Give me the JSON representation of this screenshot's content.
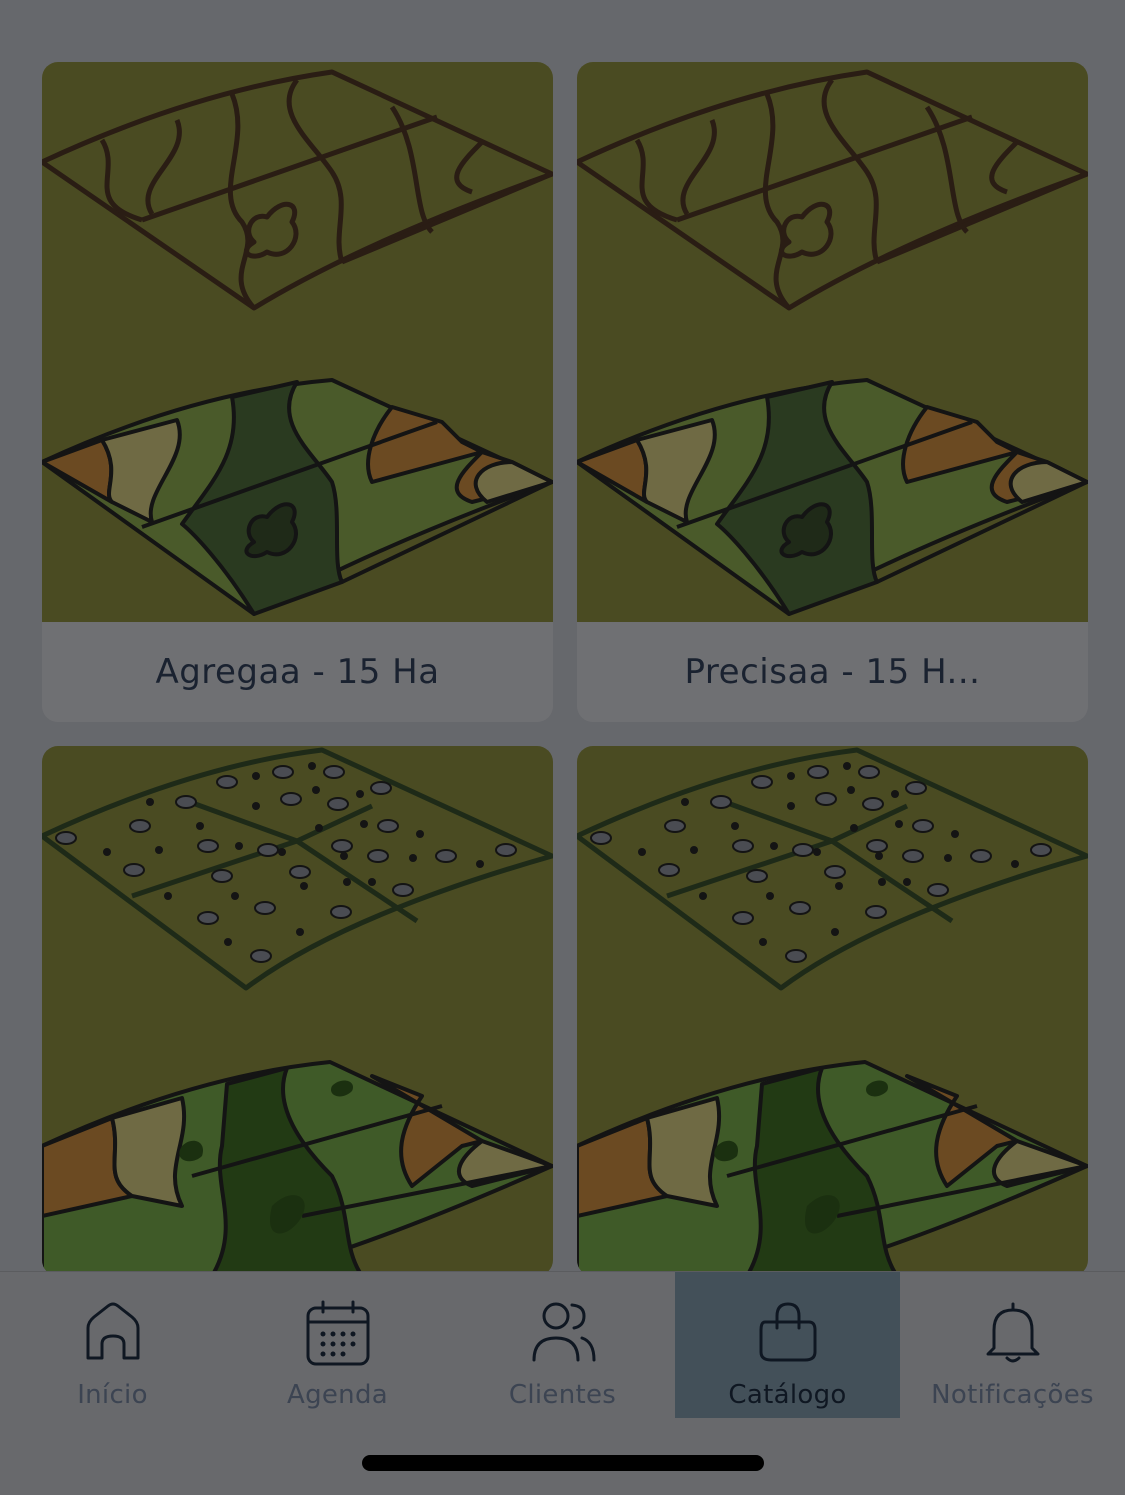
{
  "catalog": {
    "products": [
      {
        "name": "Agregaa - 15 Ha",
        "illustration": "zone-map-illustration"
      },
      {
        "name": "Precisaa - 15 H...",
        "illustration": "zone-map-illustration"
      },
      {
        "name": "",
        "illustration": "sampling-grid-illustration"
      },
      {
        "name": "",
        "illustration": "sampling-grid-illustration"
      }
    ]
  },
  "tabbar": {
    "items": [
      {
        "label": "Início",
        "icon": "home-icon",
        "active": false
      },
      {
        "label": "Agenda",
        "icon": "calendar-icon",
        "active": false
      },
      {
        "label": "Clientes",
        "icon": "users-icon",
        "active": false
      },
      {
        "label": "Catálogo",
        "icon": "bag-icon",
        "active": true
      },
      {
        "label": "Notificações",
        "icon": "bell-icon",
        "active": false
      }
    ]
  },
  "colors": {
    "overlay_bg": "#66686c",
    "card_art_bg": "#4a4b22",
    "active_tab_bg": "#435059",
    "text_dark": "#1a2230"
  }
}
